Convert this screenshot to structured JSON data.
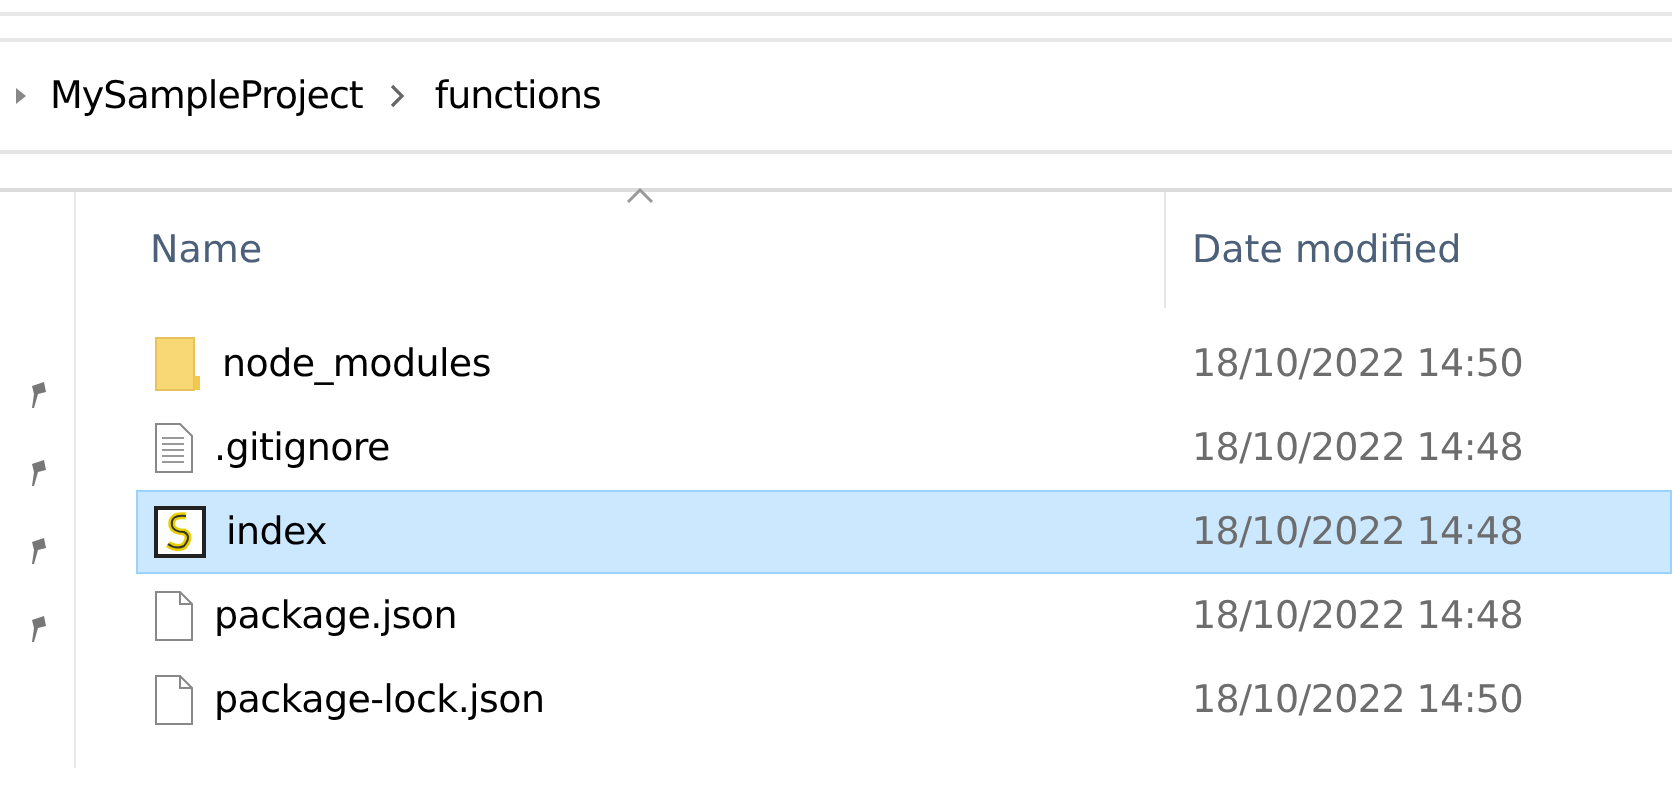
{
  "breadcrumb": [
    {
      "label": "MySampleProject"
    },
    {
      "label": "functions"
    }
  ],
  "columns": [
    "Name",
    "Date modified"
  ],
  "files": [
    {
      "name": "node_modules",
      "kind": "folder",
      "date": "18/10/2022 14:50",
      "selected": false
    },
    {
      "name": ".gitignore",
      "kind": "text",
      "date": "18/10/2022 14:48",
      "selected": false
    },
    {
      "name": "index",
      "kind": "script",
      "date": "18/10/2022 14:48",
      "selected": true
    },
    {
      "name": "package.json",
      "kind": "file",
      "date": "18/10/2022 14:48",
      "selected": false
    },
    {
      "name": "package-lock.json",
      "kind": "file",
      "date": "18/10/2022 14:50",
      "selected": false
    }
  ]
}
